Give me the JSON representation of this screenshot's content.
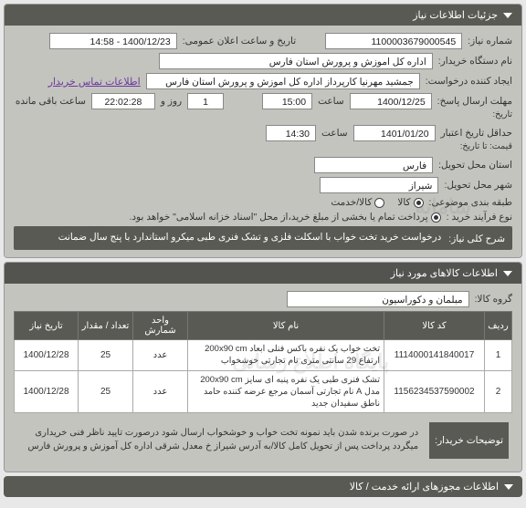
{
  "panel1": {
    "title": "جزئیات اطلاعات نیاز",
    "need_no_label": "شماره نیاز:",
    "need_no": "1100003679000545",
    "announce_label": "تاریخ و ساعت اعلان عمومی:",
    "announce_value": "1400/12/23 - 14:58",
    "buyer_org_label": "نام دستگاه خریدار:",
    "buyer_org": "اداره کل اموزش و پرورش استان فارس",
    "creator_label": "ایجاد کننده درخواست:",
    "creator": "جمشید مهرنیا کارپرداز اداره کل اموزش و پرورش استان فارس",
    "contact_link": "اطلاعات تماس خریدار",
    "deadline_label": "مهلت ارسال پاسخ:",
    "deadline_sublabel": "تاریخ:",
    "deadline_date": "1400/12/25",
    "time_label": "ساعت",
    "deadline_time": "15:00",
    "days_val": "1",
    "days_and": "روز و",
    "remaining_time": "22:02:28",
    "remaining_label": "ساعت باقی مانده",
    "validity_label": "حداقل تاریخ اعتبار",
    "validity_sublabel": "قیمت: تا تاریخ:",
    "validity_date": "1401/01/20",
    "validity_time": "14:30",
    "province_label": "استان محل تحویل:",
    "province": "فارس",
    "city_label": "شهر محل تحویل:",
    "city": "شیراز",
    "class_label": "طبقه بندی موضوعی:",
    "class_goods": "کالا",
    "class_service": "کالا/خدمت",
    "process_label": "نوع فرآیند خرید :",
    "process_note": "پرداخت تمام یا بخشی از مبلغ خرید،از محل \"اسناد خزانه اسلامی\" خواهد بود.",
    "summary_label": "شرح کلی نیاز:",
    "summary_text": "درخواست خرید تخت خواب با اسکلت فلزی و تشک فنری طبی میکرو استاندارد با پنج سال ضمانت"
  },
  "panel2": {
    "title": "اطلاعات کالاهای مورد نیاز",
    "group_label": "گروه کالا:",
    "group_value": "مبلمان و دکوراسیون",
    "cols": {
      "row": "ردیف",
      "code": "کد کالا",
      "name": "نام کالا",
      "unit": "واحد شمارش",
      "qty": "تعداد / مقدار",
      "date": "تاریخ نیاز"
    },
    "rows": [
      {
        "idx": "1",
        "code": "1114000141840017",
        "name": "تخت خواب یک نفره باکس فنلی ابعاد 200x90 cm ارتفاع 29 سانتی متری نام تجارتی خوشخواب",
        "unit": "عدد",
        "qty": "25",
        "date": "1400/12/28"
      },
      {
        "idx": "2",
        "code": "1156234537590002",
        "name": "تشک فنری طبی یک نفره پنبه ای سایز 200x90 cm مدل A نام تجارتی آسمان مرجع عرضه کننده حامد ناطق سفیدان جدید",
        "unit": "عدد",
        "qty": "25",
        "date": "1400/12/28"
      }
    ],
    "explain_label": "توضیحات خریدار:",
    "explain_text": "در صورت برنده شدن باید نمونه تخت خواب و خوشخواب ارسال شود درصورت تایید ناظر فنی خریداری میگردد پرداخت پس از تحویل کامل کالا/به آدرس شیراز خ معدل شرقی اداره کل آموزش و پرورش فارس"
  },
  "footer": {
    "title": "اطلاعات مجوزهای ارائه خدمت / کالا"
  }
}
